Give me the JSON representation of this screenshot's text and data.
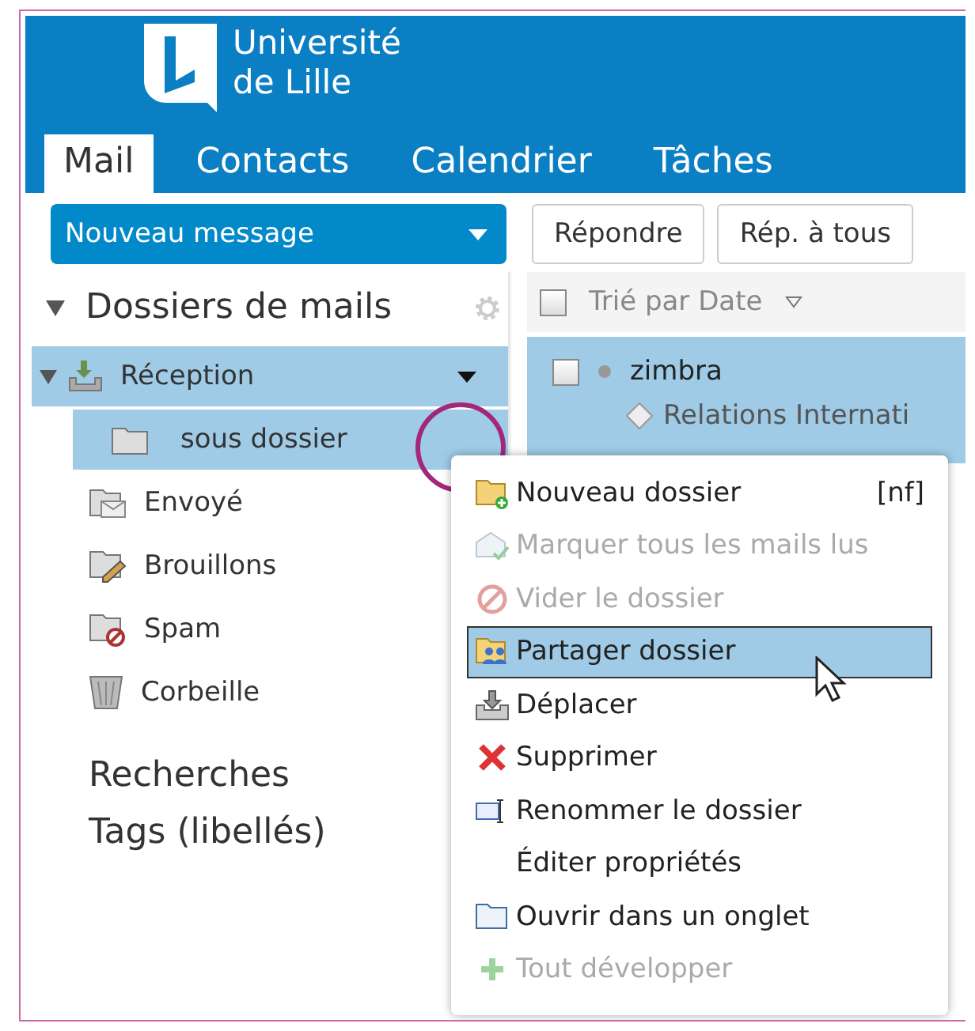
{
  "header": {
    "logo_line1": "Université",
    "logo_line2": "de Lille"
  },
  "tabs": [
    {
      "label": "Mail",
      "selected": true
    },
    {
      "label": "Contacts",
      "selected": false
    },
    {
      "label": "Calendrier",
      "selected": false
    },
    {
      "label": "Tâches",
      "selected": false
    }
  ],
  "toolbar": {
    "new_button": "Nouveau message",
    "buttons": [
      "Répondre",
      "Rép. à tous"
    ]
  },
  "folders": {
    "title": "Dossiers de mails",
    "expanded": true,
    "items": [
      {
        "label": "Réception",
        "kind": "inbox",
        "selected": true,
        "expanded": true,
        "children": [
          {
            "label": "sous dossier",
            "kind": "folder",
            "selected": true
          }
        ]
      },
      {
        "label": "Envoyé",
        "kind": "sent",
        "selected": false
      },
      {
        "label": "Brouillons",
        "kind": "drafts",
        "selected": false
      },
      {
        "label": "Spam",
        "kind": "spam",
        "selected": false
      },
      {
        "label": "Corbeille",
        "kind": "trash",
        "selected": false
      }
    ]
  },
  "sections": [
    "Recherches",
    "Tags (libellés)"
  ],
  "message_list": {
    "all_checked": false,
    "sort_label": "Trié par Date",
    "rows": [
      {
        "sender": "zimbra",
        "subject": "Relations Internati",
        "selected": true,
        "checked": false
      }
    ]
  },
  "context_menu": {
    "items": [
      {
        "label": "Nouveau dossier",
        "shortcut": "[nf]",
        "kind": "new-folder",
        "disabled": false,
        "selected": false
      },
      {
        "label": "Marquer tous les mails lus",
        "kind": "mark-read",
        "disabled": true,
        "selected": false
      },
      {
        "label": "Vider le dossier",
        "kind": "empty",
        "disabled": true,
        "selected": false
      },
      {
        "label": "Partager dossier",
        "kind": "share",
        "disabled": false,
        "selected": true
      },
      {
        "label": "Déplacer",
        "kind": "move",
        "disabled": false,
        "selected": false
      },
      {
        "label": "Supprimer",
        "kind": "delete",
        "disabled": false,
        "selected": false
      },
      {
        "label": "Renommer le dossier",
        "kind": "rename",
        "disabled": false,
        "selected": false
      },
      {
        "label": "Éditer propriétés",
        "kind": "plain",
        "disabled": false,
        "selected": false
      },
      {
        "label": "Ouvrir dans un onglet",
        "kind": "open-tab",
        "disabled": false,
        "selected": false
      },
      {
        "label": "Tout développer",
        "kind": "expand-all",
        "disabled": true,
        "selected": false
      }
    ]
  }
}
